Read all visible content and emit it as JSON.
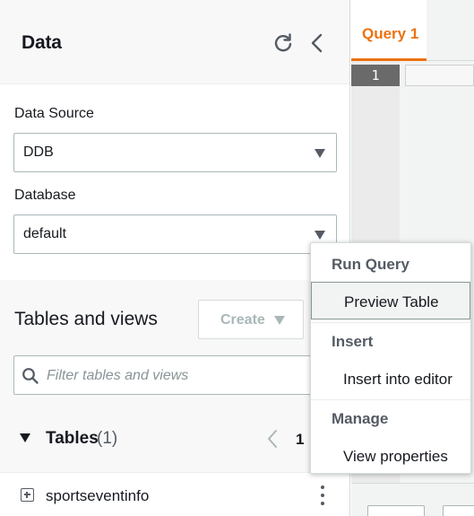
{
  "panel": {
    "title": "Data",
    "icons": {
      "refresh": "refresh-icon",
      "collapse": "chevron-left-icon"
    }
  },
  "data_source": {
    "label": "Data Source",
    "value": "DDB"
  },
  "database": {
    "label": "Database",
    "value": "default"
  },
  "tables_and_views": {
    "title": "Tables and views",
    "create_label": "Create",
    "search_placeholder": "Filter tables and views"
  },
  "tables": {
    "label": "Tables",
    "count": "(1)",
    "page": "1",
    "items": [
      {
        "name": "sportseventinfo"
      }
    ]
  },
  "editor": {
    "tab_label": "Query 1",
    "line_number": "1"
  },
  "context_menu": {
    "groups": [
      {
        "label": "Run Query",
        "items": [
          "Preview Table"
        ]
      },
      {
        "label": "Insert",
        "items": [
          "Insert into editor"
        ]
      },
      {
        "label": "Manage",
        "items": [
          "View properties"
        ]
      }
    ]
  },
  "colors": {
    "accent": "#ec7211",
    "text": "#16191f",
    "muted": "#545b64",
    "border": "#aab7b8"
  }
}
